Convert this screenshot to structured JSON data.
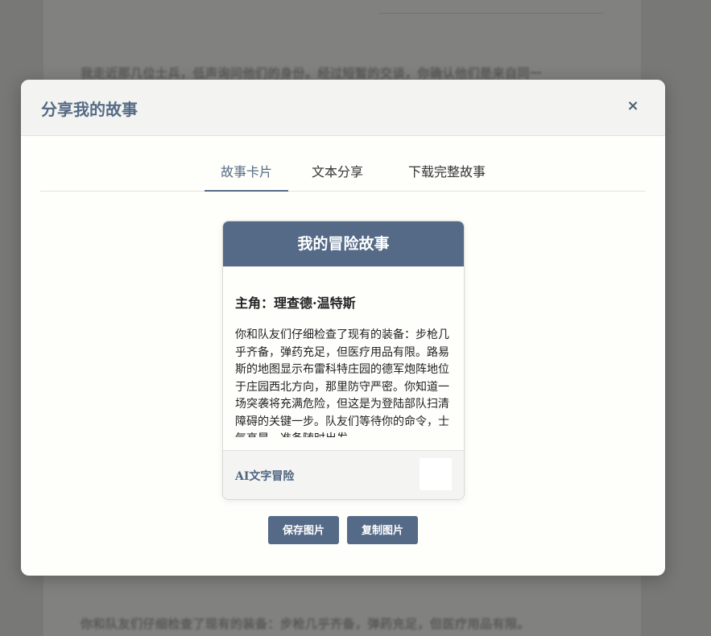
{
  "background": {
    "text_top": "我走近那几位士兵，低声询问他们的身份。经过短暂的交谈，你确认他们是来自同一",
    "text_bottom": "你和队友们仔细检查了现有的装备：步枪几乎齐备，弹药充足，但医疗用品有限。"
  },
  "modal": {
    "title": "分享我的故事",
    "close_icon": "×"
  },
  "tabs": [
    {
      "label": "故事卡片",
      "active": true
    },
    {
      "label": "文本分享",
      "active": false
    },
    {
      "label": "下载完整故事",
      "active": false
    }
  ],
  "card": {
    "title": "我的冒险故事",
    "protagonist": "主角：理查德·温特斯",
    "body": "你和队友们仔细检查了现有的装备：步枪几乎齐备，弹药充足，但医疗用品有限。路易斯的地图显示布雷科特庄园的德军炮阵地位于庄园西北方向，那里防守严密。你知道一场突袭将充满危险，但这是为登陆部队扫清障碍的关键一步。队友们等待你的命令，士气高昂，准备随时出发。",
    "brand": "AI文字冒险"
  },
  "buttons": {
    "save": "保存图片",
    "copy": "复制图片"
  },
  "colors": {
    "accent": "#546a87",
    "backdrop": "#7f7f7d"
  }
}
